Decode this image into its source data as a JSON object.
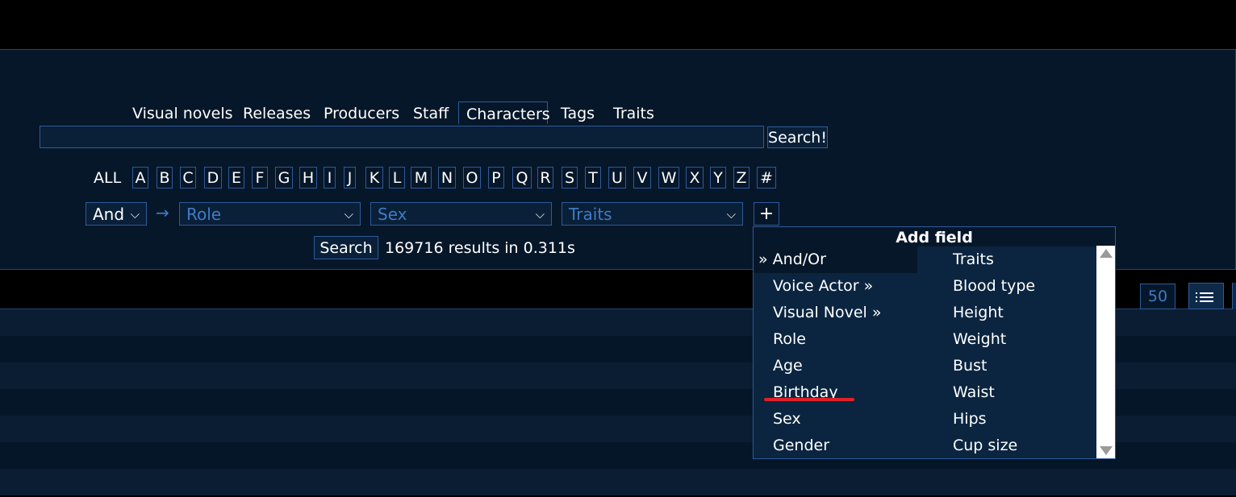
{
  "nav": {
    "tabs": [
      {
        "label": "Visual novels"
      },
      {
        "label": "Releases"
      },
      {
        "label": "Producers"
      },
      {
        "label": "Staff"
      },
      {
        "label": "Characters"
      },
      {
        "label": "Tags"
      },
      {
        "label": "Traits"
      }
    ],
    "active_tab": "Characters"
  },
  "search": {
    "query": "",
    "button_label": "Search!"
  },
  "alphabet": {
    "all_label": "ALL",
    "letters": [
      "A",
      "B",
      "C",
      "D",
      "E",
      "F",
      "G",
      "H",
      "I",
      "J",
      "K",
      "L",
      "M",
      "N",
      "O",
      "P",
      "Q",
      "R",
      "S",
      "T",
      "U",
      "V",
      "W",
      "X",
      "Y",
      "Z",
      "#"
    ]
  },
  "filters": {
    "logic": "And",
    "role_placeholder": "Role",
    "sex_placeholder": "Sex",
    "traits_placeholder": "Traits",
    "add_label": "+",
    "arrow": "→"
  },
  "results": {
    "search_label": "Search",
    "summary": "169716 results in 0.311s"
  },
  "toolbar": {
    "per_page": "50"
  },
  "add_field": {
    "title": "Add field",
    "left_column": [
      "» And/Or",
      "Voice Actor »",
      "Visual Novel »",
      "Role",
      "Age",
      "Birthday",
      "Sex",
      "Gender"
    ],
    "right_column": [
      "Traits",
      "Blood type",
      "Height",
      "Weight",
      "Bust",
      "Waist",
      "Hips",
      "Cup size"
    ]
  },
  "colors": {
    "background": "#07172a",
    "border": "#2e5a99",
    "accent_text": "#3f7bc7",
    "highlight_underline": "#e0202a"
  }
}
